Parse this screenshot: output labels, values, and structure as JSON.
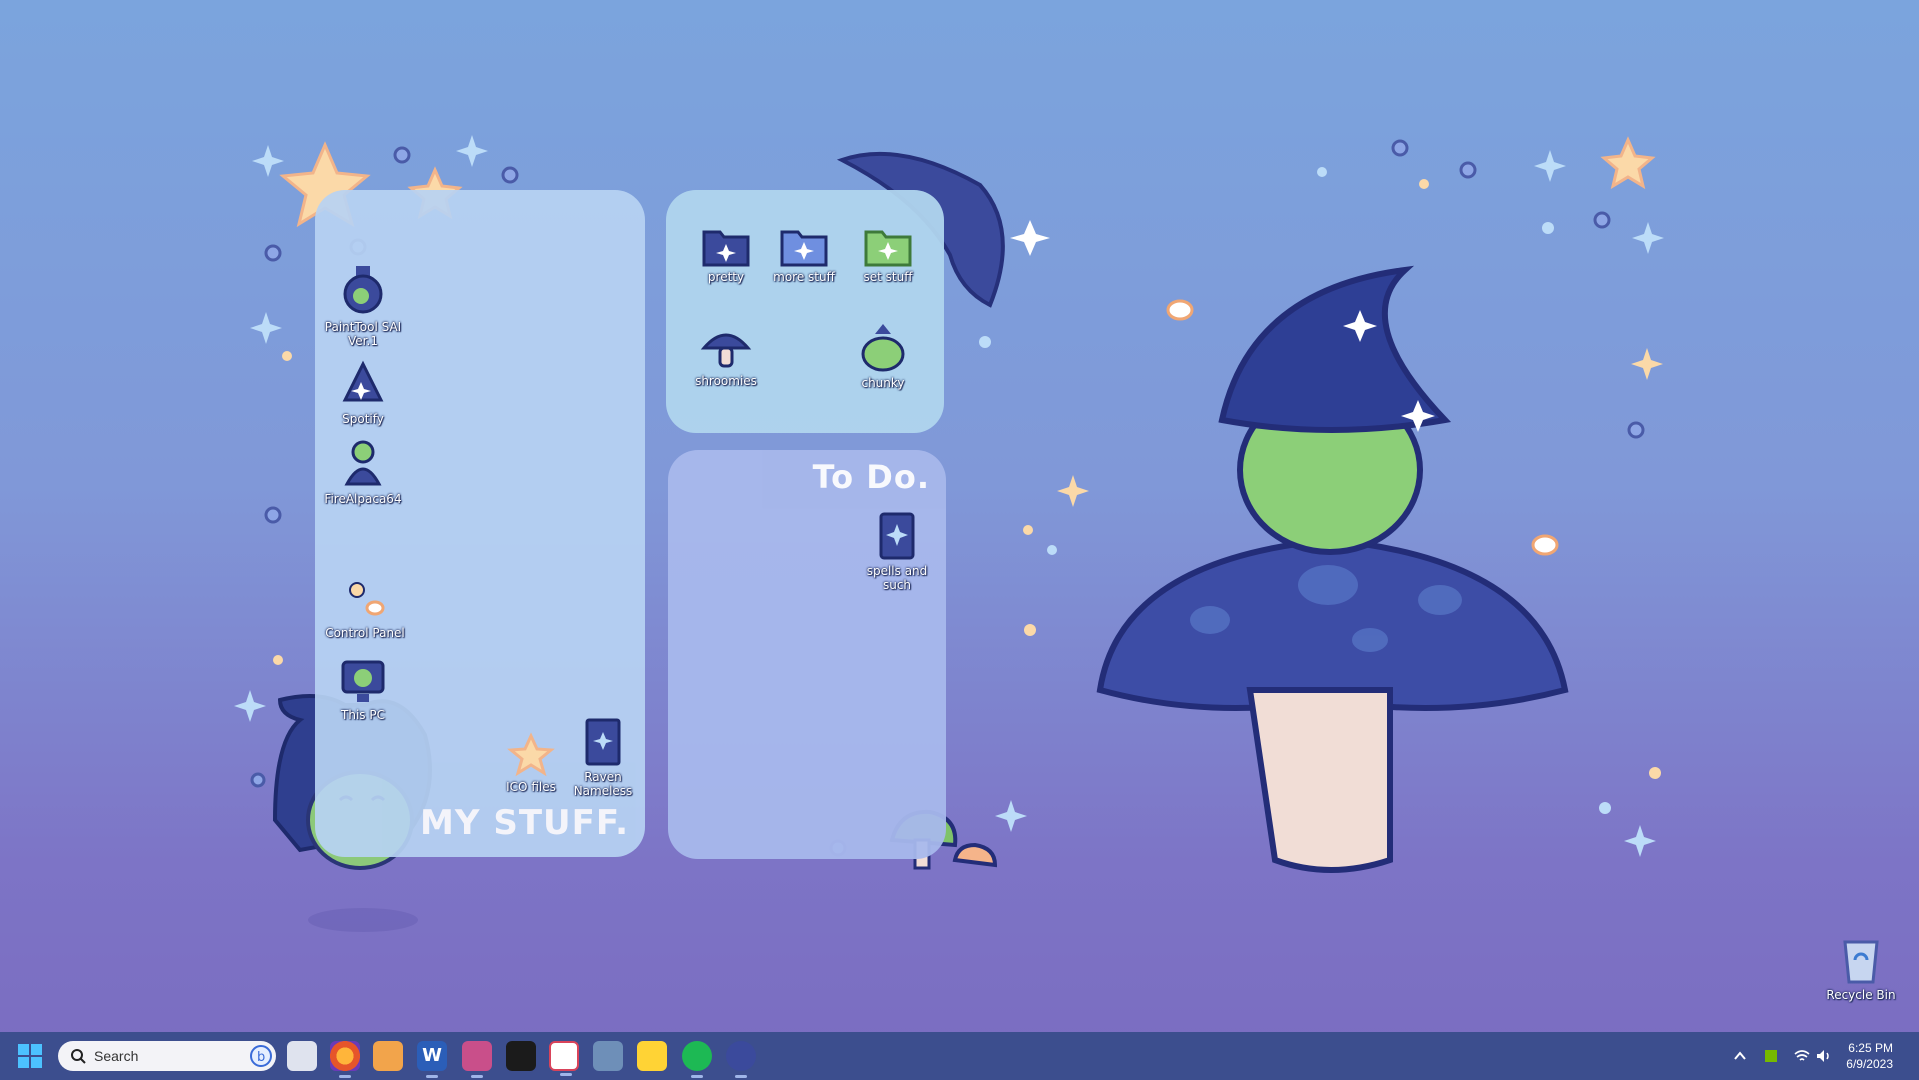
{
  "panels": {
    "left_title": "MY STUFF.",
    "todo_title": "To Do."
  },
  "desktop_icons": {
    "paint_tool_sai": "PaintTool SAI\nVer.1",
    "spotify": "Spotify",
    "firealpaca": "FireAlpaca64",
    "control_panel": "Control Panel",
    "this_pc": "This PC",
    "ico_files": "ICO files",
    "raven_nameless": "Raven\nNameless",
    "pretty": "pretty",
    "more_stuff": "more stuff",
    "set_stuff": "set stuff",
    "shroomies": "shroomies",
    "chunky": "chunky",
    "spells_and_such": "spells and\nsuch",
    "recycle_bin": "Recycle Bin"
  },
  "taskbar": {
    "search_placeholder": "Search",
    "apps": [
      "start-icon",
      "task-view-icon",
      "firefox-icon",
      "media-player-icon",
      "word-icon",
      "app-icon",
      "terminal-icon",
      "snipping-tool-icon",
      "calculator-icon",
      "sticky-notes-icon",
      "spotify-icon",
      "paint-tool-icon"
    ],
    "time": "6:25 PM",
    "date": "6/9/2023"
  },
  "colors": {
    "taskbar": "#3c4e8e",
    "panel_left": "#b7d3f3",
    "panel_top": "#b0d5ee",
    "panel_bottom": "#a8b8ec",
    "accent": "#4cc2ff"
  }
}
